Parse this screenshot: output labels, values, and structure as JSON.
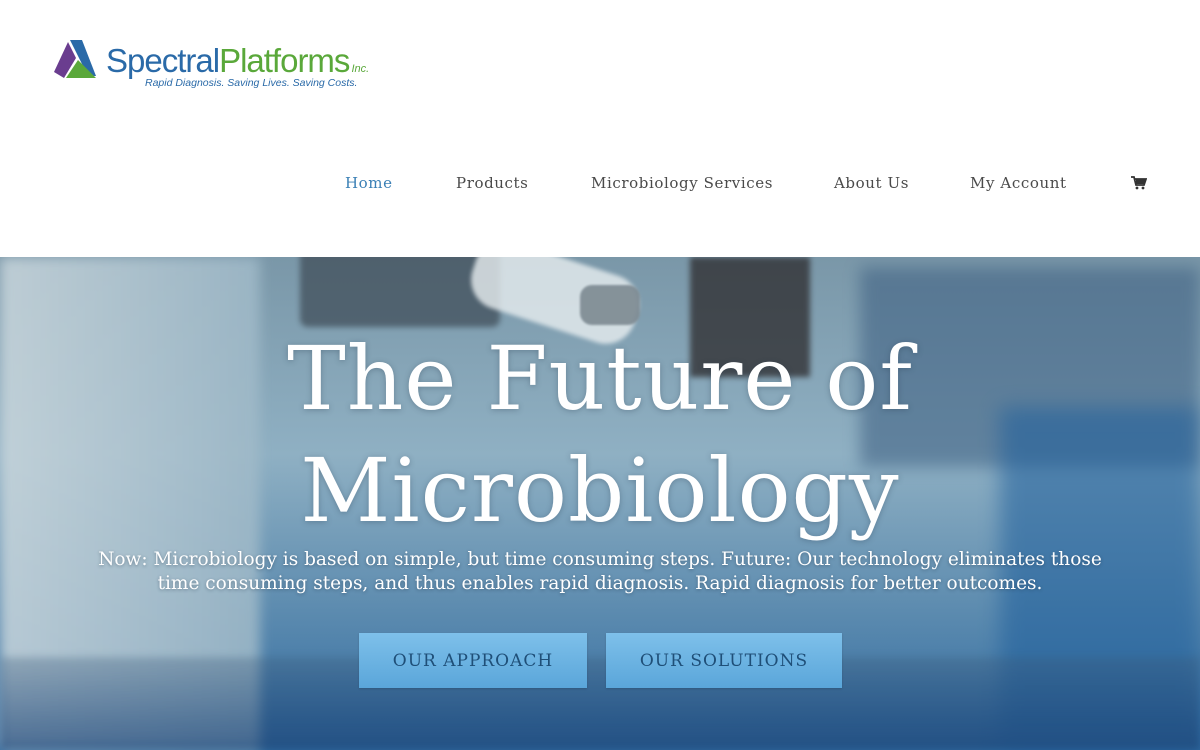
{
  "logo": {
    "word1": "Spectral",
    "word2": "Platforms",
    "suffix": "Inc.",
    "tagline": "Rapid Diagnosis. Saving Lives. Saving Costs.",
    "colors": {
      "blue": "#2a6aa8",
      "green": "#5aa83a",
      "purple": "#6a3d8f"
    }
  },
  "nav": {
    "items": [
      {
        "label": "Home",
        "active": true
      },
      {
        "label": "Products",
        "active": false
      },
      {
        "label": "Microbiology Services",
        "active": false
      },
      {
        "label": "About Us",
        "active": false
      },
      {
        "label": "My Account",
        "active": false
      }
    ],
    "cart_icon": "shopping-cart-icon",
    "active_color": "#3a7fb5"
  },
  "hero": {
    "title_line1": "The Future of",
    "title_line2": "Microbiology",
    "subtitle": "Now: Microbiology is based on simple, but time consuming steps. Future: Our technology eliminates those time consuming steps, and thus enables rapid diagnosis. Rapid diagnosis for better outcomes.",
    "buttons": [
      {
        "label": "OUR APPROACH"
      },
      {
        "label": "OUR SOLUTIONS"
      }
    ],
    "button_color": "#6bb3e3"
  }
}
